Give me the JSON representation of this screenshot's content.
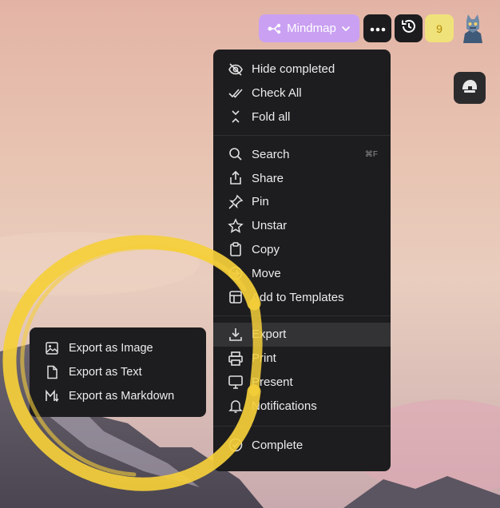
{
  "toolbar": {
    "view_mode_label": "Mindmap",
    "view_mode_icon": "mindmap-icon",
    "more_icon": "more-dots-icon",
    "history_icon": "history-icon",
    "badge_count": "9"
  },
  "menu": {
    "groups": [
      [
        {
          "label": "Hide completed",
          "icon": "eye-off-icon"
        },
        {
          "label": "Check All",
          "icon": "double-check-icon"
        },
        {
          "label": "Fold all",
          "icon": "fold-icon"
        }
      ],
      [
        {
          "label": "Search",
          "icon": "search-icon",
          "shortcut": "⌘F"
        },
        {
          "label": "Share",
          "icon": "share-icon"
        },
        {
          "label": "Pin",
          "icon": "pin-icon"
        },
        {
          "label": "Unstar",
          "icon": "star-icon"
        },
        {
          "label": "Copy",
          "icon": "clipboard-icon"
        },
        {
          "label": "Move",
          "icon": "move-icon"
        },
        {
          "label": "Add to Templates",
          "icon": "template-icon"
        }
      ],
      [
        {
          "label": "Export",
          "icon": "export-icon",
          "active": true
        },
        {
          "label": "Print",
          "icon": "print-icon"
        },
        {
          "label": "Present",
          "icon": "present-icon"
        },
        {
          "label": "Notifications",
          "icon": "bell-icon"
        }
      ],
      [
        {
          "label": "Complete",
          "icon": "check-circle-icon"
        }
      ]
    ]
  },
  "export_submenu": {
    "items": [
      {
        "label": "Export as Image",
        "icon": "image-icon"
      },
      {
        "label": "Export as Text",
        "icon": "file-icon"
      },
      {
        "label": "Export as Markdown",
        "icon": "markdown-icon"
      }
    ]
  },
  "colors": {
    "accent": "#c9a0f2",
    "menu_bg": "#1d1d1f",
    "highlight_ring": "#f5cf3a",
    "badge_bg": "#f0e27a"
  }
}
